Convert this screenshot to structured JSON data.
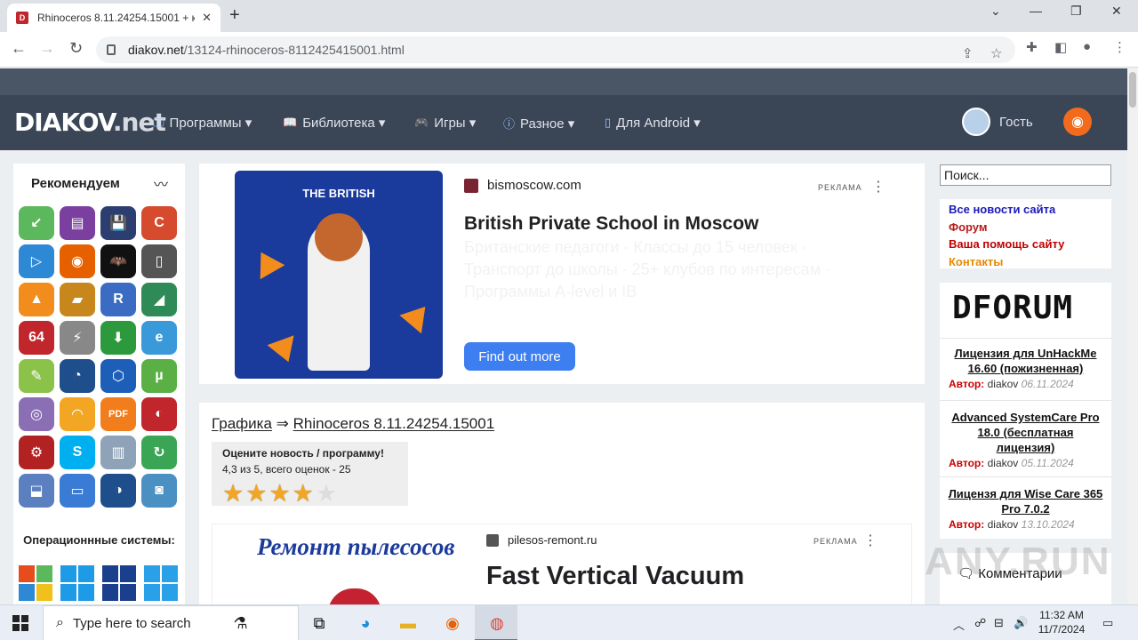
{
  "browser": {
    "tab_title": "Rhinoceros 8.11.24254.15001 + к",
    "tab_close": "✕",
    "new_tab": "+",
    "url_domain": "diakov.net",
    "url_path": "/13124-rhinoceros-8112425415001.html",
    "window_controls": [
      "⌄",
      "—",
      "❐",
      "✕"
    ]
  },
  "site": {
    "logo_main": "DIAKOV",
    "logo_suffix": ".net",
    "menu": [
      {
        "icon": "🖵",
        "label": "Программы ▾"
      },
      {
        "icon": "📖",
        "label": "Библиотека ▾"
      },
      {
        "icon": "🎮",
        "label": "Игры ▾"
      },
      {
        "icon": "ⓘ",
        "label": "Разное ▾"
      },
      {
        "icon": "▯",
        "label": "Для Android ▾"
      }
    ],
    "guest_label": "Гость"
  },
  "left": {
    "recommend_title": "Рекомендуем",
    "trend_icon": "〰",
    "apps": [
      {
        "name": "download",
        "glyph": "↙",
        "color": "#5cb85c"
      },
      {
        "name": "winrar",
        "glyph": "▤",
        "color": "#7b3fa0"
      },
      {
        "name": "floppy",
        "glyph": "💾",
        "color": "#2c3e70"
      },
      {
        "name": "ccleaner",
        "glyph": "C",
        "color": "#d64a2e"
      },
      {
        "name": "player",
        "glyph": "▷",
        "color": "#2d88d6"
      },
      {
        "name": "firefox",
        "glyph": "◉",
        "color": "#e66000"
      },
      {
        "name": "batman",
        "glyph": "🦇",
        "color": "#111111"
      },
      {
        "name": "terminal",
        "glyph": "▯",
        "color": "#555555"
      },
      {
        "name": "aimp",
        "glyph": "▲",
        "color": "#f28c1c"
      },
      {
        "name": "totalcmd",
        "glyph": "▰",
        "color": "#c8871c"
      },
      {
        "name": "revo",
        "glyph": "R",
        "color": "#3a6cc4"
      },
      {
        "name": "chart",
        "glyph": "◢",
        "color": "#2e8b57"
      },
      {
        "name": "aida64",
        "glyph": "64",
        "color": "#c0262b"
      },
      {
        "name": "flash",
        "glyph": "⚡",
        "color": "#888888"
      },
      {
        "name": "idm",
        "glyph": "⬇",
        "color": "#2c9a3c"
      },
      {
        "name": "ie",
        "glyph": "e",
        "color": "#3a9ad9"
      },
      {
        "name": "greenshot",
        "glyph": "✎",
        "color": "#8bc34a"
      },
      {
        "name": "eye",
        "glyph": "◔",
        "color": "#1e4f8c"
      },
      {
        "name": "cube",
        "glyph": "⬡",
        "color": "#1d5fb8"
      },
      {
        "name": "utorrent",
        "glyph": "µ",
        "color": "#5ab045"
      },
      {
        "name": "disc",
        "glyph": "◎",
        "color": "#8a6fb5"
      },
      {
        "name": "speedo",
        "glyph": "◠",
        "color": "#f2a623"
      },
      {
        "name": "pdf",
        "glyph": "PDF",
        "color": "#f27d1c"
      },
      {
        "name": "partition",
        "glyph": "◐",
        "color": "#c0262b"
      },
      {
        "name": "iobit",
        "glyph": "⚙",
        "color": "#b22222"
      },
      {
        "name": "skype",
        "glyph": "S",
        "color": "#00aff0"
      },
      {
        "name": "trash",
        "glyph": "▥",
        "color": "#8fa3b8"
      },
      {
        "name": "updater",
        "glyph": "↻",
        "color": "#3aa655"
      },
      {
        "name": "scan",
        "glyph": "⬓",
        "color": "#5b7fbf"
      },
      {
        "name": "monitor",
        "glyph": "▭",
        "color": "#3a7bd5"
      },
      {
        "name": "backup",
        "glyph": "◑",
        "color": "#1e4f8c"
      },
      {
        "name": "hdd",
        "glyph": "◙",
        "color": "#4a90c2"
      }
    ],
    "os_title": "Операционнные системы:",
    "os_icons": [
      "windows-xp",
      "windows-8",
      "windows-7",
      "windows-10"
    ]
  },
  "ad1": {
    "image_brand": "THE BRITISH",
    "source": "bismoscow.com",
    "label": "РЕКЛАМА",
    "headline": "British Private School in Moscow",
    "description": "Британские педагоги · Классы до 15 человек · Транспорт до школы · 25+ клубов по интересам · Программы A-level и IB",
    "cta": "Find out more"
  },
  "article": {
    "category": "Графика",
    "arrow": "⇒",
    "title": "Rhinoceros 8.11.24254.15001",
    "rating_prompt": "Оцените новость / программу!",
    "rating_text": "4,3 из 5, всего оценок - 25",
    "rating_value": 4.3,
    "rating_max": 5
  },
  "ad2": {
    "image_text": "Ремонт пылесосов",
    "source": "pilesos-remont.ru",
    "label": "РЕКЛАМА",
    "headline": "Fast Vertical Vacuum"
  },
  "right": {
    "search_value": "Поиск...",
    "links": [
      {
        "label": "Все новости сайта",
        "color": "#1a1ab8"
      },
      {
        "label": "Форум",
        "color": "#b81a1a"
      },
      {
        "label": "Ваша помощь сайту",
        "color": "#c00000"
      },
      {
        "label": "Контакты",
        "color": "#e68a00"
      }
    ],
    "forum_logo": "DFORUM",
    "posts": [
      {
        "title": "Лицензия для UnHackMe 16.60 (пожизненная)",
        "author_label": "Автор:",
        "author": "diakov",
        "date": "06.11.2024"
      },
      {
        "title": "Advanced SystemCare Pro 18.0 (бесплатная лицензия)",
        "author_label": "Автор:",
        "author": "diakov",
        "date": "05.11.2024"
      },
      {
        "title": "Лицензя для Wise Care 365 Pro 7.0.2",
        "author_label": "Автор:",
        "author": "diakov",
        "date": "13.10.2024"
      }
    ],
    "comments_title": "🗨 Комментарии",
    "watermark": "ANY.RUN"
  },
  "taskbar": {
    "search_placeholder": "Type here to search",
    "time": "11:32 AM",
    "date": "11/7/2024"
  }
}
